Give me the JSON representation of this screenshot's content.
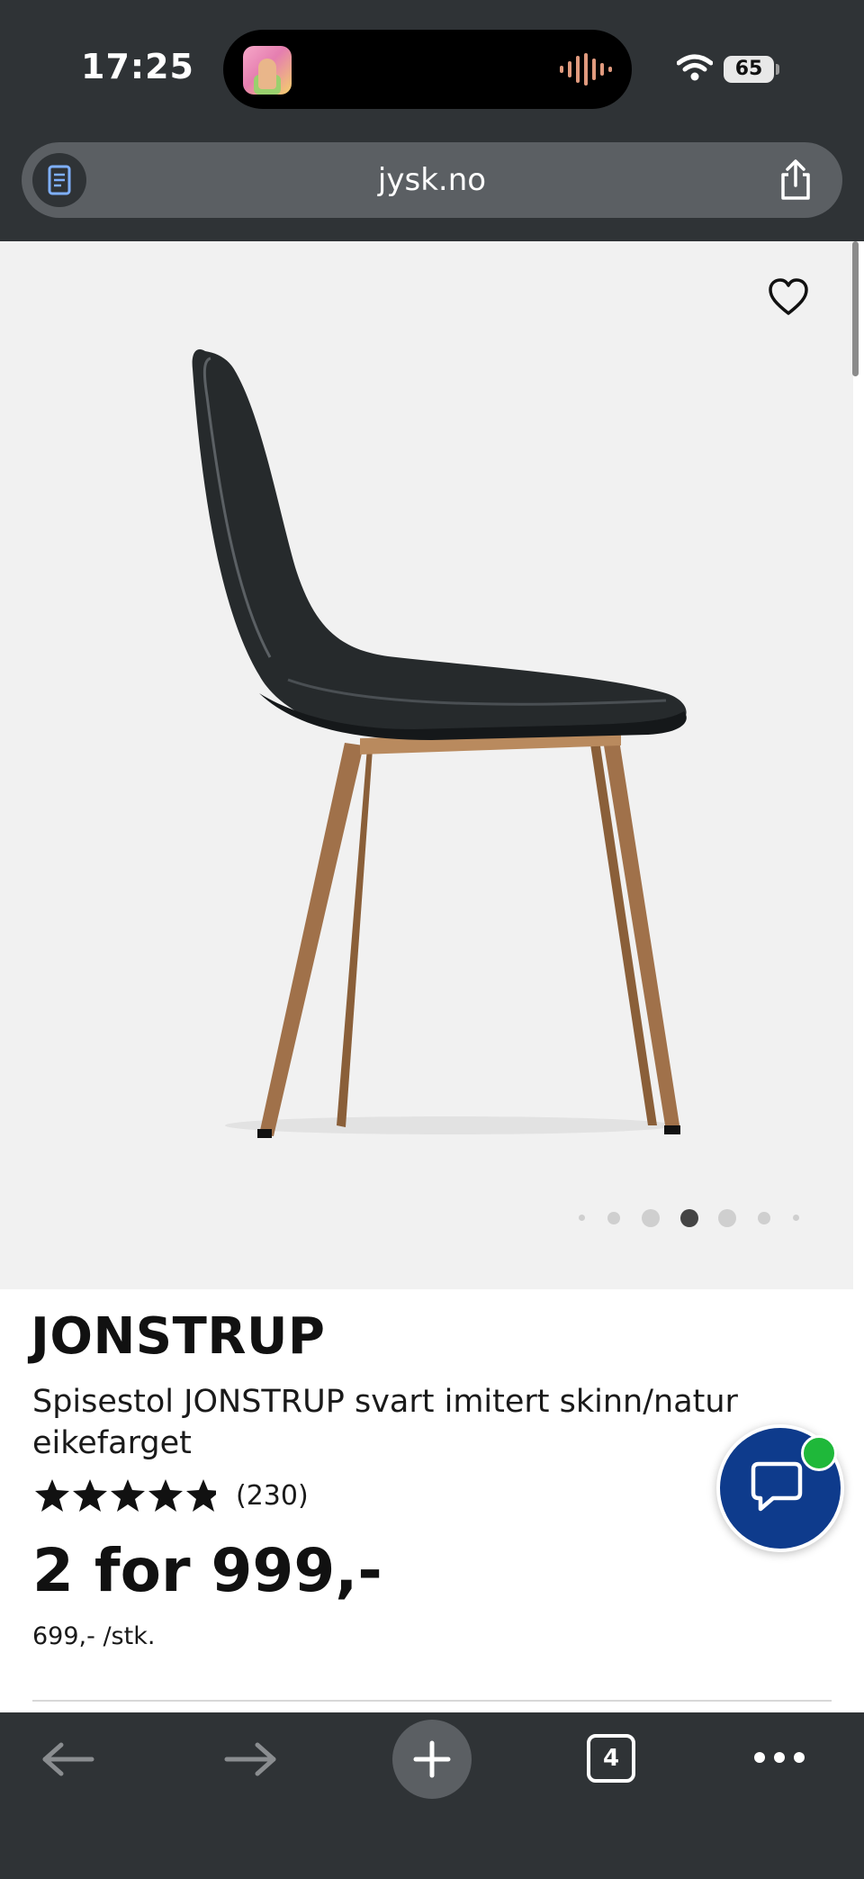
{
  "status_bar": {
    "time": "17:25",
    "battery": "65"
  },
  "browser": {
    "url": "jysk.no",
    "tab_count": "4"
  },
  "product": {
    "name": "JONSTRUP",
    "description": "Spisestol JONSTRUP svart imitert skinn/natur eikefarget",
    "rating_stars": 4.8,
    "review_count": "(230)",
    "price": "2 for 999,-",
    "unit_price": "699,- /stk.",
    "image_count": 7,
    "active_image_index": 3
  },
  "icons": {
    "favorite": "heart-icon",
    "chat": "chat-bubble-icon",
    "reader": "reader-mode-icon",
    "share": "share-icon",
    "back": "arrow-left-icon",
    "forward": "arrow-right-icon",
    "new_tab": "plus-icon",
    "more": "ellipsis-icon"
  },
  "colors": {
    "browser_chrome": "#2f3336",
    "chat_button": "#0e3b8c",
    "online_indicator": "#1fb83a",
    "image_background": "#f1f1f1"
  }
}
